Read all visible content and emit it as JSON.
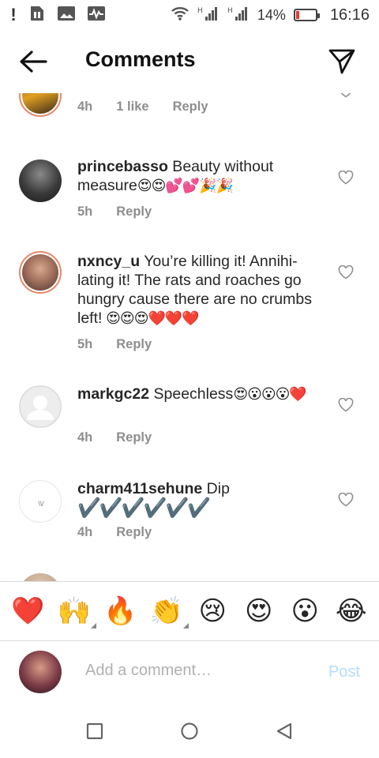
{
  "status_bar": {
    "battery_pct": "14%",
    "time": "16:16",
    "battery_level": 0.14,
    "icons": [
      "alert-icon",
      "sim-icon",
      "gallery-icon",
      "activity-icon",
      "wifi-icon",
      "signal-icon",
      "signal-icon",
      "battery-icon"
    ]
  },
  "header": {
    "title": "Comments",
    "back_icon": "arrow-left-icon",
    "share_icon": "paper-plane-icon"
  },
  "comments": [
    {
      "username": "",
      "text": "",
      "time": "4h",
      "likes": "1 like",
      "reply": "Reply",
      "partial": true
    },
    {
      "username": "princebasso",
      "text": " Beauty without measure",
      "emojis": "😍😍💕💕",
      "tail_emojis": "🎉🎉",
      "time": "5h",
      "reply": "Reply"
    },
    {
      "username": "nxncy_u",
      "text": " You’re killing it! Annihi-lating it! The rats and roaches go hungry cause there are no crumbs left!",
      "emojis": " 😍😍😍❤️❤️❤️",
      "time": "5h",
      "reply": "Reply"
    },
    {
      "username": "markgc22",
      "text": " Speechless",
      "emojis": "😍😮😮😮❤️",
      "time": "4h",
      "reply": "Reply"
    },
    {
      "username": "charm411sehune",
      "text": " Dip",
      "emojis": "✔️✔️✔️✔️✔️✔️",
      "time": "4h",
      "reply": "Reply"
    }
  ],
  "reactions": [
    "❤️",
    "🙌",
    "🔥",
    "👏",
    "😢",
    "😍",
    "😮",
    "😂"
  ],
  "composer": {
    "placeholder": "Add a comment…",
    "post_label": "Post"
  },
  "colors": {
    "heart_red": "#e0245e",
    "post_blue_disabled": "#b3dbff",
    "meta_gray": "#8e8e8e"
  }
}
